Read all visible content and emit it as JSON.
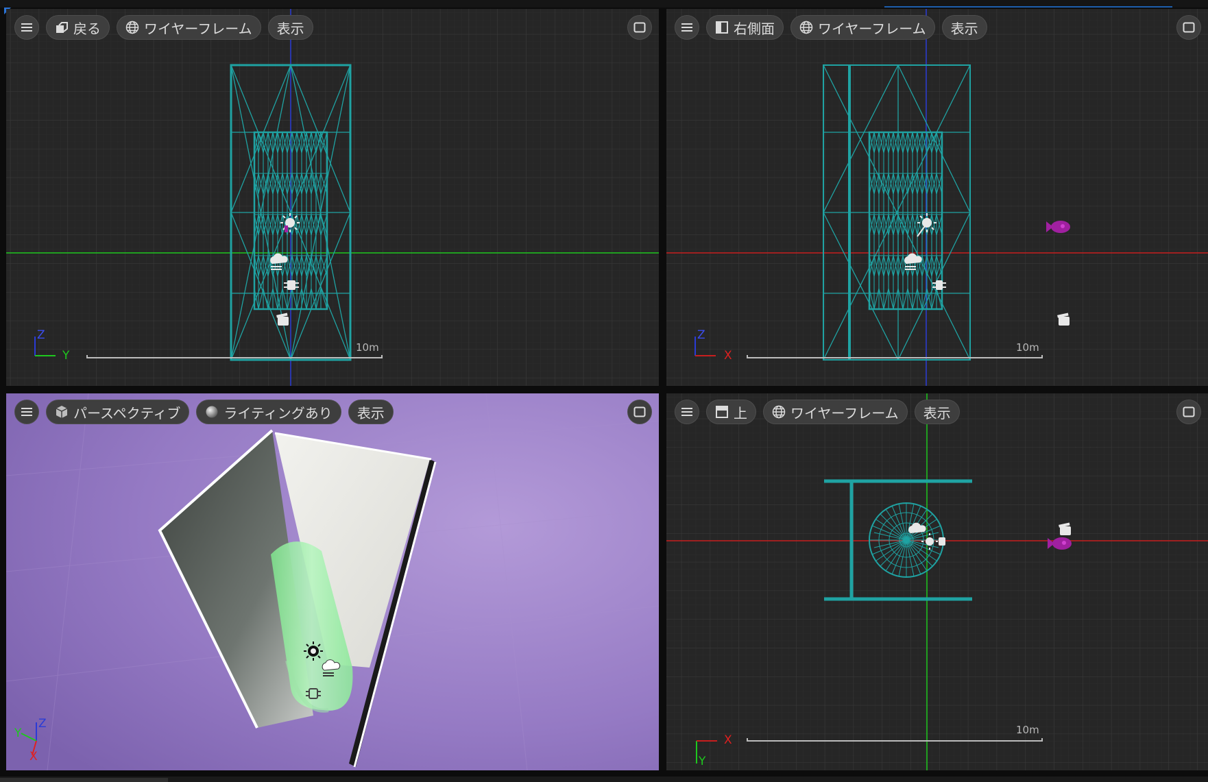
{
  "viewports": {
    "front": {
      "title": "戻る",
      "title_icon": "front-view-cube-icon",
      "shading": "ワイヤーフレーム",
      "shading_icon": "wireframe-sphere-icon",
      "show": "表示",
      "axis_v": "Z",
      "axis_h": "Y",
      "scale": "10m"
    },
    "right": {
      "title": "右側面",
      "title_icon": "side-view-icon",
      "shading": "ワイヤーフレーム",
      "shading_icon": "wireframe-sphere-icon",
      "show": "表示",
      "axis_v": "Z",
      "axis_h": "X",
      "scale": "10m"
    },
    "perspective": {
      "title": "パースペクティブ",
      "title_icon": "perspective-cube-icon",
      "shading": "ライティングあり",
      "shading_icon": "lit-sphere-icon",
      "show": "表示",
      "axis_z": "Z",
      "axis_y": "Y",
      "axis_x": "X"
    },
    "top": {
      "title": "上",
      "title_icon": "top-view-icon",
      "shading": "ワイヤーフレーム",
      "shading_icon": "wireframe-sphere-icon",
      "show": "表示",
      "axis_h": "X",
      "axis_v": "Y",
      "scale": "10m"
    }
  },
  "colors": {
    "grid_bg": "#262626",
    "wire": "#1fa3a3",
    "x_axis": "#c81e1e",
    "y_axis": "#1ec81e",
    "z_axis": "#2a3bd6",
    "perspective_bg": "#9678c4",
    "camera_actor": "#a020a0"
  }
}
